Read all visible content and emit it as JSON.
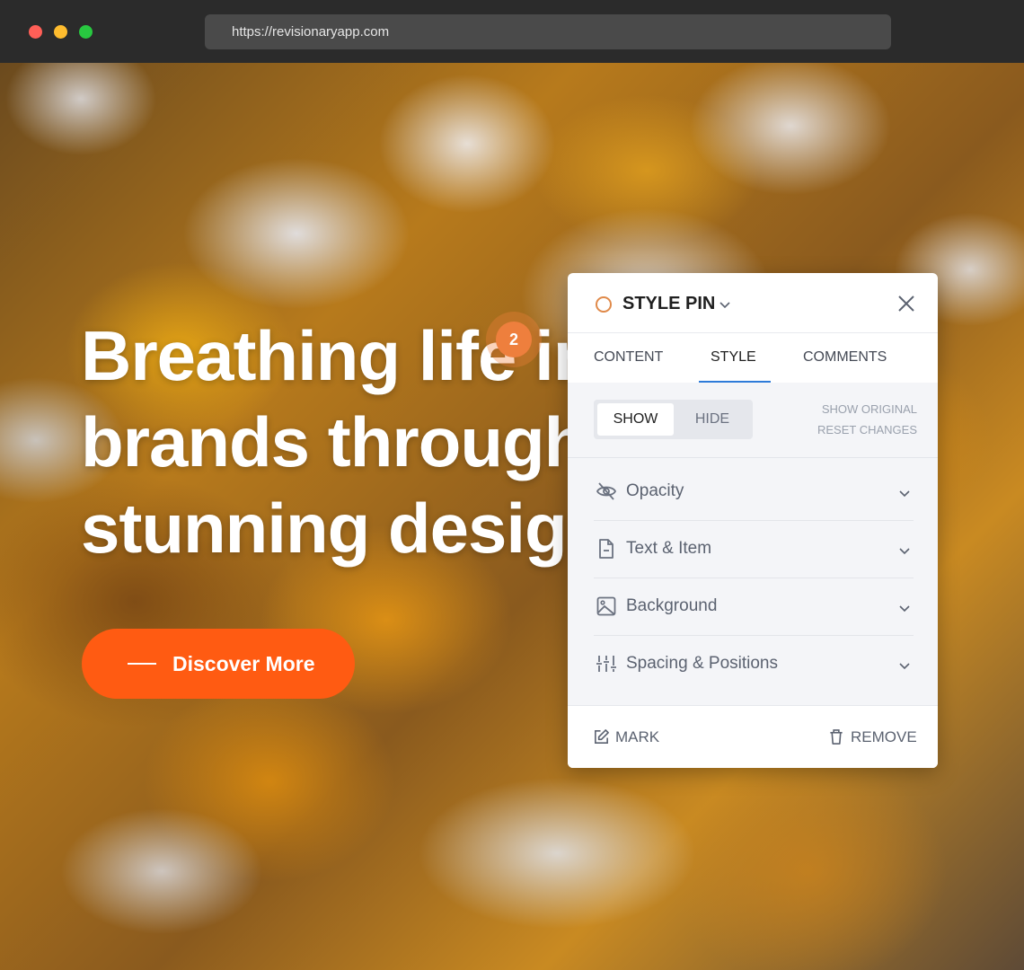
{
  "browser": {
    "url": "https://revisionaryapp.com"
  },
  "hero": {
    "title_lines": [
      "Breathing life int",
      "brands through",
      "stunning design"
    ],
    "cta_label": "Discover More"
  },
  "pin": {
    "number": "2"
  },
  "panel": {
    "title": "STYLE PIN",
    "tabs": [
      {
        "label": "CONTENT",
        "active": false
      },
      {
        "label": "STYLE",
        "active": true
      },
      {
        "label": "COMMENTS",
        "active": false
      }
    ],
    "toggle": {
      "show": "SHOW",
      "hide": "HIDE",
      "selected": "SHOW"
    },
    "links": {
      "show_original": "SHOW ORIGINAL",
      "reset_changes": "RESET CHANGES"
    },
    "sections": [
      {
        "label": "Opacity",
        "icon": "eye-off-icon"
      },
      {
        "label": "Text & Item",
        "icon": "file-text-icon"
      },
      {
        "label": "Background",
        "icon": "image-icon"
      },
      {
        "label": "Spacing & Positions",
        "icon": "sliders-icon"
      }
    ],
    "footer": {
      "mark": "MARK",
      "remove": "REMOVE"
    }
  },
  "colors": {
    "accent_orange": "#ff5b12",
    "pin_orange": "#ee7f3d",
    "tab_underline": "#2e7bd9"
  }
}
